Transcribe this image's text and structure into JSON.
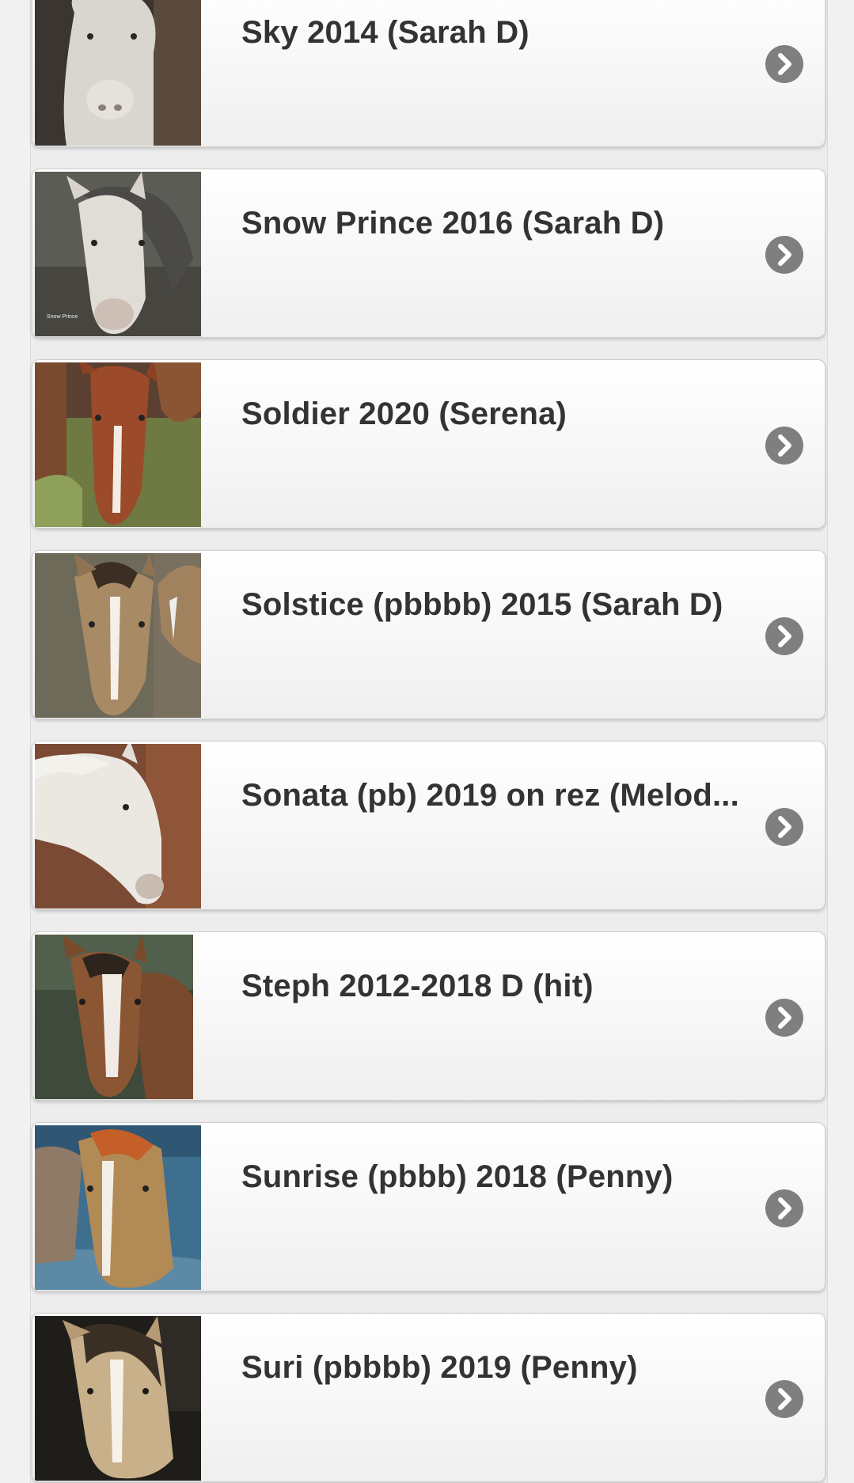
{
  "items": [
    {
      "label": "Sky 2014 (Sarah D)",
      "icon": "chevron-right-icon"
    },
    {
      "label": "Snow Prince 2016 (Sarah D)",
      "icon": "chevron-right-icon"
    },
    {
      "label": "Soldier 2020 (Serena)",
      "icon": "chevron-right-icon"
    },
    {
      "label": "Solstice (pbbbb) 2015 (Sarah D)",
      "icon": "chevron-right-icon"
    },
    {
      "label": "Sonata (pb) 2019 on rez (Melod...",
      "icon": "chevron-right-icon"
    },
    {
      "label": "Steph 2012-2018 D (hit)",
      "icon": "chevron-right-icon"
    },
    {
      "label": "Sunrise (pbbb) 2018 (Penny)",
      "icon": "chevron-right-icon"
    },
    {
      "label": "Suri (pbbbb) 2019 (Penny)",
      "icon": "chevron-right-icon"
    }
  ],
  "colors": {
    "text": "#333333",
    "chevron_bg": "#7f7f7f",
    "item_bg": "#f6f6f6",
    "page_bg": "#f1f1f1"
  }
}
